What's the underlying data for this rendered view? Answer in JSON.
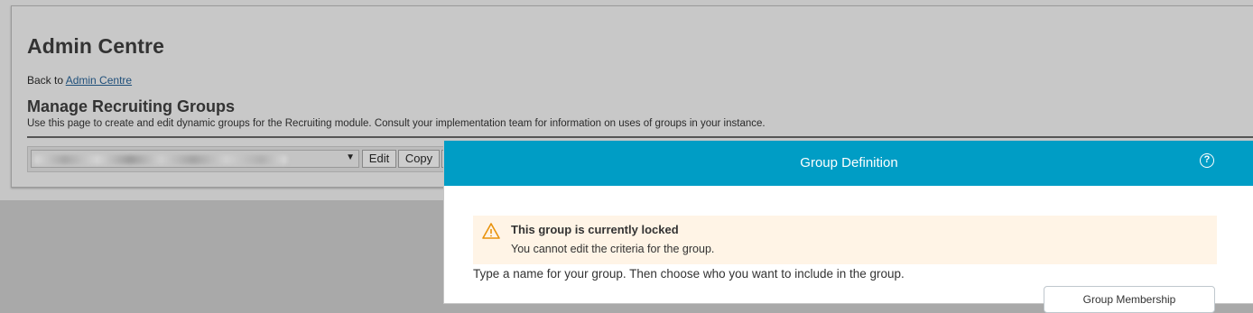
{
  "page": {
    "title": "Admin Centre",
    "back_prefix": "Back to",
    "back_link": "Admin Centre",
    "section_title": "Manage Recruiting Groups",
    "section_description": "Use this page to create and edit dynamic groups for the Recruiting module. Consult your implementation team for information on uses of groups in your instance."
  },
  "toolbar": {
    "group_select_value": "",
    "edit_label": "Edit",
    "copy_label": "Copy"
  },
  "dialog": {
    "title": "Group Definition",
    "help_icon": "question-circle-icon",
    "alert": {
      "icon": "warning-triangle-icon",
      "title": "This group is currently locked",
      "body": "You cannot edit the criteria for the group."
    },
    "instructions": "Type a name for your group. Then choose who you want to include in the group.",
    "membership_button_label": "Group Membership"
  },
  "colors": {
    "header": "#009dc5",
    "alert_bg": "#fff4e6",
    "warning": "#e8920c",
    "link": "#1f4f7a"
  }
}
